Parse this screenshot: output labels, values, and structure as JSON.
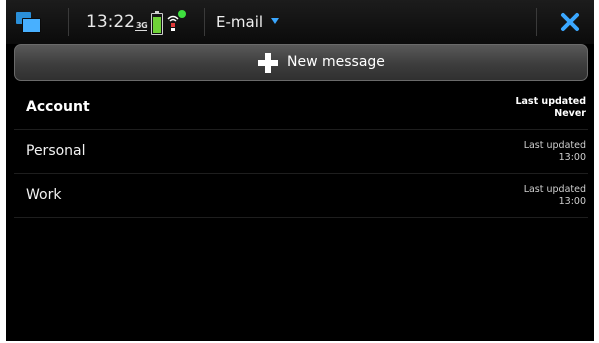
{
  "statusbar": {
    "time": "13:22",
    "network": "3G",
    "app_title": "E-mail",
    "colors": {
      "accent": "#3aa7ff",
      "battery": "#6fd238",
      "wifi_dot": "#3ee03e"
    }
  },
  "new_message": {
    "label": "New message"
  },
  "list": {
    "header": {
      "name": "Account",
      "updated_label": "Last updated",
      "updated_value": "Never"
    },
    "accounts": [
      {
        "name": "Personal",
        "updated_label": "Last updated",
        "updated_value": "13:00"
      },
      {
        "name": "Work",
        "updated_label": "Last updated",
        "updated_value": "13:00"
      }
    ]
  }
}
